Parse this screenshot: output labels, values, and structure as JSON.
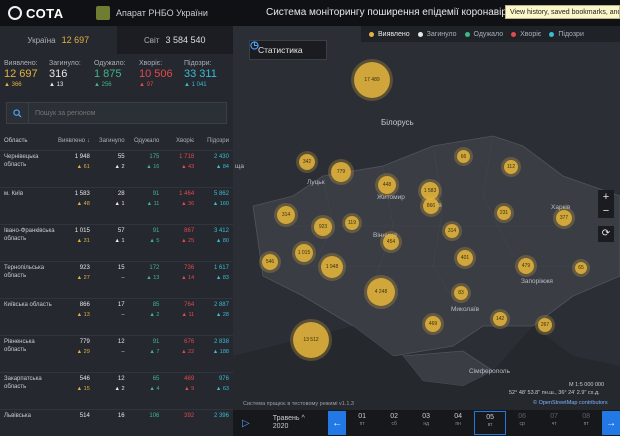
{
  "header": {
    "logo_text": "СОТА",
    "org": "Апарат РНБО України",
    "title": "Система моніторингу поширення епідемії коронавірусу",
    "browser_tooltip": "View history, saved bookmarks, and more"
  },
  "tabs": [
    {
      "label": "Україна",
      "value": "12 697"
    },
    {
      "label": "Світ",
      "value": "3 584 540"
    }
  ],
  "stats": [
    {
      "label": "Виявлено:",
      "value": "12 697",
      "delta": "366"
    },
    {
      "label": "Загинуло:",
      "value": "316",
      "delta": "13"
    },
    {
      "label": "Одужало:",
      "value": "1 875",
      "delta": "256"
    },
    {
      "label": "Хворіє:",
      "value": "10 506",
      "delta": "97"
    },
    {
      "label": "Підозри:",
      "value": "33 311",
      "delta": "1 041"
    }
  ],
  "search": {
    "placeholder": "Пошук за регіоном"
  },
  "table": {
    "headers": [
      "Область",
      "Виявлено ↓",
      "Загинуло",
      "Одужало",
      "Хворіє",
      "Підозри"
    ],
    "rows": [
      {
        "region": "Чернівецька область",
        "c": [
          "1 948",
          "55",
          "175",
          "1 718",
          "2 430"
        ],
        "d": [
          "61",
          "2",
          "16",
          "43",
          "84"
        ]
      },
      {
        "region": "м. Київ",
        "c": [
          "1 583",
          "28",
          "91",
          "1 464",
          "5 862"
        ],
        "d": [
          "48",
          "1",
          "11",
          "36",
          "160"
        ]
      },
      {
        "region": "Івано-Франківська область",
        "c": [
          "1 015",
          "57",
          "91",
          "867",
          "3 412"
        ],
        "d": [
          "31",
          "1",
          "5",
          "25",
          "80"
        ]
      },
      {
        "region": "Тернопільська область",
        "c": [
          "923",
          "15",
          "172",
          "736",
          "1 617"
        ],
        "d": [
          "27",
          "–",
          "13",
          "14",
          "83"
        ]
      },
      {
        "region": "Київська область",
        "c": [
          "866",
          "17",
          "85",
          "764",
          "2 887"
        ],
        "d": [
          "13",
          "–",
          "2",
          "11",
          "28"
        ]
      },
      {
        "region": "Рівненська область",
        "c": [
          "779",
          "12",
          "91",
          "676",
          "2 838"
        ],
        "d": [
          "29",
          "–",
          "7",
          "22",
          "188"
        ]
      },
      {
        "region": "Закарпатська область",
        "c": [
          "546",
          "12",
          "65",
          "469",
          "976"
        ],
        "d": [
          "15",
          "2",
          "4",
          "9",
          "63"
        ]
      },
      {
        "region": "Львівська",
        "c": [
          "514",
          "16",
          "106",
          "392",
          "2 396"
        ],
        "d": [
          "",
          "",
          "",
          "",
          ""
        ]
      }
    ]
  },
  "map": {
    "stat_button": "Статистика",
    "legend": [
      "Виявлено",
      "Загинуло",
      "Одужало",
      "Хворіє",
      "Підозри"
    ],
    "legend_colors": [
      "#e3b341",
      "#e8e8e8",
      "#3fb68b",
      "#e5484d",
      "#38bdd4"
    ],
    "place_labels": [
      "Білорусь",
      "Луцьк",
      "Житомир",
      "Київ",
      "Харків",
      "Запоріжжя",
      "Миколаїв",
      "Сімферополь",
      "Вінниця",
      "ща"
    ],
    "clusters": [
      "17 489",
      "342",
      "779",
      "448",
      "1 583",
      "66",
      "112",
      "866",
      "231",
      "377",
      "314",
      "923",
      "1 015",
      "119",
      "454",
      "546",
      "1 948",
      "401",
      "479",
      "65",
      "4 248",
      "83",
      "469",
      "142",
      "267",
      "13 512",
      "314"
    ],
    "scale": "M 1:5 000 000",
    "coords": "52° 48' 53.8\" пн.ш., 36° 24' 2.9\" сх.д.",
    "attribution": "© OpenStreetMap contributors",
    "test_note": "Система працює в тестовому режимі v1.1.3"
  },
  "timeline": {
    "month": "Травень",
    "year": "2020",
    "days": [
      {
        "n": "01",
        "wd": "пт"
      },
      {
        "n": "02",
        "wd": "сб"
      },
      {
        "n": "03",
        "wd": "нд"
      },
      {
        "n": "04",
        "wd": "пн"
      },
      {
        "n": "05",
        "wd": "вт"
      },
      {
        "n": "06",
        "wd": "ср"
      },
      {
        "n": "07",
        "wd": "чт"
      },
      {
        "n": "08",
        "wd": "пт"
      }
    ]
  }
}
